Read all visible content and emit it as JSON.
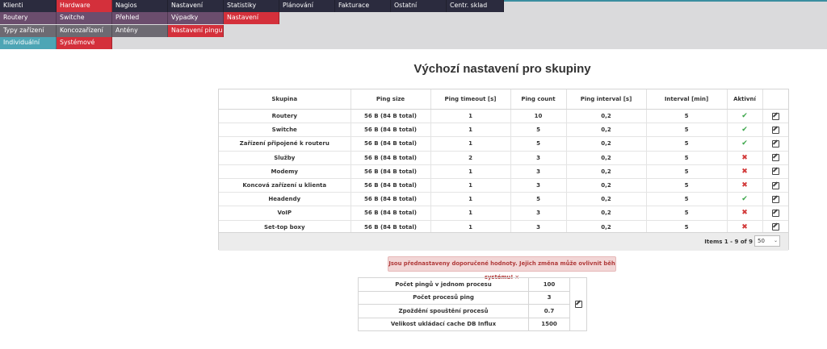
{
  "menu": {
    "row1": [
      "Klienti",
      "Hardware",
      "Nagios",
      "Nastavení",
      "Statistiky",
      "Plánování",
      "Fakturace",
      "Ostatní",
      "Centr. sklad"
    ],
    "row2": [
      "Routery",
      "Switche",
      "Přehled",
      "Výpadky",
      "Nastavení"
    ],
    "row3": [
      "Typy zařízení",
      "Koncozařízení",
      "Antény",
      "Nastavení pingu"
    ],
    "row4": [
      "Individuální",
      "Systémové"
    ]
  },
  "page_title": "Výchozí nastavení pro skupiny",
  "grid": {
    "columns": [
      "Skupina",
      "Ping size",
      "Ping timeout [s]",
      "Ping count",
      "Ping interval [s]",
      "Interval [min]",
      "Aktivní",
      ""
    ],
    "rows": [
      {
        "group": "Routery",
        "size": "56 B (84 B total)",
        "timeout": "1",
        "count": "10",
        "interval": "0,2",
        "min": "5",
        "active": true
      },
      {
        "group": "Switche",
        "size": "56 B (84 B total)",
        "timeout": "1",
        "count": "5",
        "interval": "0,2",
        "min": "5",
        "active": true
      },
      {
        "group": "Zařízení připojené k routeru",
        "size": "56 B (84 B total)",
        "timeout": "1",
        "count": "5",
        "interval": "0,2",
        "min": "5",
        "active": true
      },
      {
        "group": "Služby",
        "size": "56 B (84 B total)",
        "timeout": "2",
        "count": "3",
        "interval": "0,2",
        "min": "5",
        "active": false
      },
      {
        "group": "Modemy",
        "size": "56 B (84 B total)",
        "timeout": "1",
        "count": "3",
        "interval": "0,2",
        "min": "5",
        "active": false
      },
      {
        "group": "Koncová zařízení u klienta",
        "size": "56 B (84 B total)",
        "timeout": "1",
        "count": "3",
        "interval": "0,2",
        "min": "5",
        "active": false
      },
      {
        "group": "Headendy",
        "size": "56 B (84 B total)",
        "timeout": "1",
        "count": "5",
        "interval": "0,2",
        "min": "5",
        "active": true
      },
      {
        "group": "VoIP",
        "size": "56 B (84 B total)",
        "timeout": "1",
        "count": "3",
        "interval": "0,2",
        "min": "5",
        "active": false
      },
      {
        "group": "Set-top boxy",
        "size": "56 B (84 B total)",
        "timeout": "1",
        "count": "3",
        "interval": "0,2",
        "min": "5",
        "active": false
      }
    ],
    "pager_info": "Items 1 - 9 of 9",
    "page_size": "50"
  },
  "alert": {
    "text": "Jsou přednastaveny doporučené hodnoty. Jejich změna může ovlivnit běh systému!",
    "close": "×"
  },
  "config": [
    {
      "label": "Počet pingů v jednom procesu",
      "value": "100"
    },
    {
      "label": "Počet procesů ping",
      "value": "3"
    },
    {
      "label": "Zpoždění spouštění procesů",
      "value": "0.7"
    },
    {
      "label": "Velikost ukládací cache DB Influx",
      "value": "1500"
    }
  ],
  "icons": {
    "active": "check-icon",
    "inactive": "cross-icon",
    "edit": "edit-icon"
  },
  "colors": {
    "menu_dark": "#2b2b3e",
    "menu_purple": "#6b4d6d",
    "menu_red": "#d4303b",
    "menu_teal": "#4da5b5",
    "ok": "#3aa548",
    "no": "#d23a3a"
  }
}
